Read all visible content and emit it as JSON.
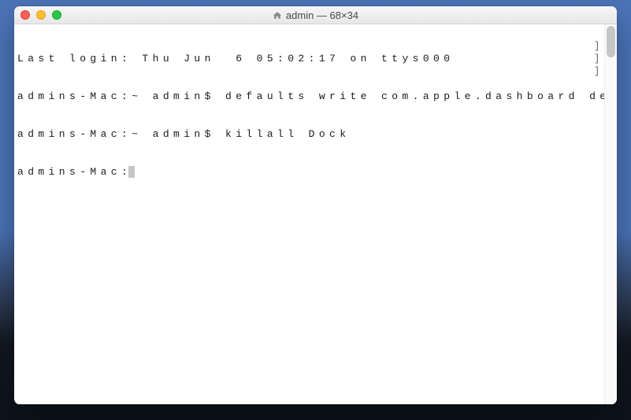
{
  "window": {
    "title": "admin — 68×34"
  },
  "terminal": {
    "lines": [
      "Last login: Thu Jun  6 05:02:17 on ttys000",
      "admins-Mac:~ admin$ defaults write com.apple.dashboard devmode NO",
      "admins-Mac:~ admin$ killall Dock",
      "admins-Mac:"
    ],
    "right_brackets": [
      "",
      "]",
      "]",
      "]"
    ]
  }
}
